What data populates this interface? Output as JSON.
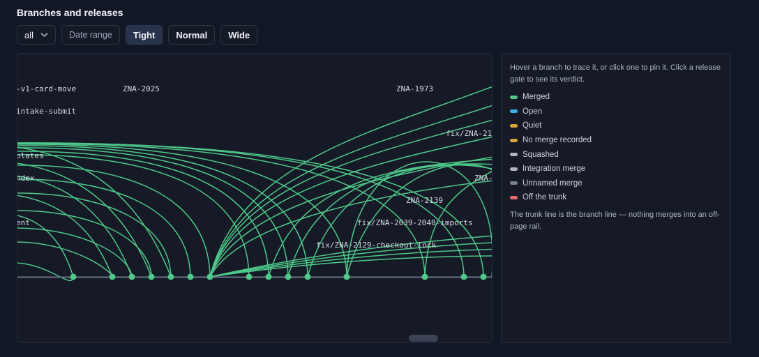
{
  "page": {
    "title": "Branches and releases"
  },
  "toolbar": {
    "filter_value": "all",
    "date_range_label": "Date range",
    "density_options": [
      "Tight",
      "Normal",
      "Wide"
    ],
    "density_selected": "Tight"
  },
  "graph": {
    "branch_labels": [
      "-v1-card-move",
      "ZNA-2025",
      "ZNA-1973",
      "intake-submit",
      "fix/ZNA-21",
      "plates",
      "ndex",
      "ZNA-",
      "ZNA-2139",
      "ent",
      "fix/ZNA-2039-2040-imports",
      "fix/ZNA-2129-checkout-lock"
    ]
  },
  "legend": {
    "hint": "Hover a branch to trace it, or click one to pin it. Click a release gate to see its verdict.",
    "items": [
      {
        "label": "Merged",
        "color": "#4fc98a"
      },
      {
        "label": "Open",
        "color": "#3ab2ea"
      },
      {
        "label": "Quiet",
        "color": "#d8a33a"
      },
      {
        "label": "No merge recorded",
        "color": "#d8a33a"
      },
      {
        "label": "Squashed",
        "color": "#aeb4c0"
      },
      {
        "label": "Integration merge",
        "color": "#aeb4c0"
      },
      {
        "label": "Unnamed merge",
        "color": "#7a8292"
      },
      {
        "label": "Off the trunk",
        "color": "#e96a6a"
      }
    ],
    "note": "The trunk line is the branch line — nothing merges into an off-page rail."
  },
  "colors": {
    "merged": "#4fc98a",
    "trunk": "#6b7385"
  }
}
